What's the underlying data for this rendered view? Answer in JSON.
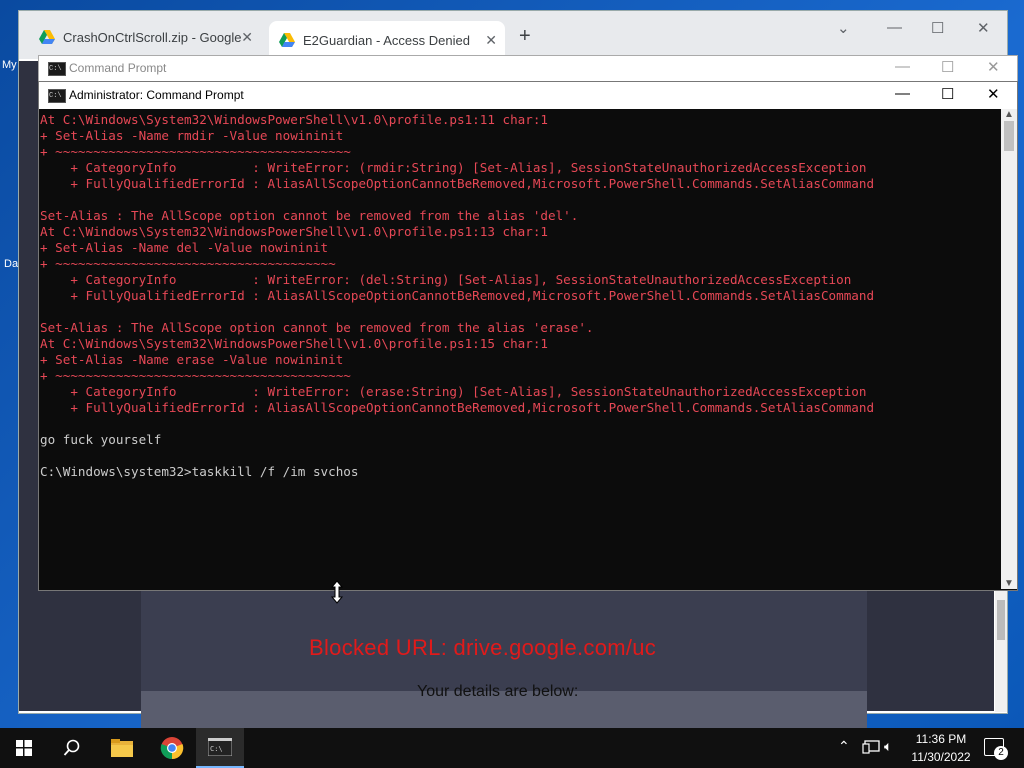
{
  "desktop": {
    "icon_labels": [
      "My",
      "Da"
    ]
  },
  "chrome": {
    "tabs": [
      {
        "title": "CrashOnCtrlScroll.zip - Google D",
        "close": "✕",
        "icon": "google-drive-icon"
      },
      {
        "title": "E2Guardian - Access Denied",
        "close": "✕",
        "icon": "google-drive-icon"
      }
    ],
    "new_tab": "+",
    "page": {
      "blocked_text": "Blocked URL: drive.google.com/uc",
      "details_text": "Your details are below:"
    }
  },
  "cmd_back": {
    "title": "Command Prompt"
  },
  "cmd": {
    "title": "Administrator: Command Prompt",
    "lines": [
      {
        "text": "At C:\\Windows\\System32\\WindowsPowerShell\\v1.0\\profile.ps1:11 char:1",
        "color": "red"
      },
      {
        "text": "+ Set-Alias -Name rmdir -Value nowininit",
        "color": "red"
      },
      {
        "text": "+ ~~~~~~~~~~~~~~~~~~~~~~~~~~~~~~~~~~~~~~~",
        "color": "red"
      },
      {
        "text": "    + CategoryInfo          : WriteError: (rmdir:String) [Set-Alias], SessionStateUnauthorizedAccessException",
        "color": "red"
      },
      {
        "text": "    + FullyQualifiedErrorId : AliasAllScopeOptionCannotBeRemoved,Microsoft.PowerShell.Commands.SetAliasCommand",
        "color": "red"
      },
      {
        "text": "",
        "color": "red"
      },
      {
        "text": "Set-Alias : The AllScope option cannot be removed from the alias 'del'.",
        "color": "red"
      },
      {
        "text": "At C:\\Windows\\System32\\WindowsPowerShell\\v1.0\\profile.ps1:13 char:1",
        "color": "red"
      },
      {
        "text": "+ Set-Alias -Name del -Value nowininit",
        "color": "red"
      },
      {
        "text": "+ ~~~~~~~~~~~~~~~~~~~~~~~~~~~~~~~~~~~~~",
        "color": "red"
      },
      {
        "text": "    + CategoryInfo          : WriteError: (del:String) [Set-Alias], SessionStateUnauthorizedAccessException",
        "color": "red"
      },
      {
        "text": "    + FullyQualifiedErrorId : AliasAllScopeOptionCannotBeRemoved,Microsoft.PowerShell.Commands.SetAliasCommand",
        "color": "red"
      },
      {
        "text": "",
        "color": "red"
      },
      {
        "text": "Set-Alias : The AllScope option cannot be removed from the alias 'erase'.",
        "color": "red"
      },
      {
        "text": "At C:\\Windows\\System32\\WindowsPowerShell\\v1.0\\profile.ps1:15 char:1",
        "color": "red"
      },
      {
        "text": "+ Set-Alias -Name erase -Value nowininit",
        "color": "red"
      },
      {
        "text": "+ ~~~~~~~~~~~~~~~~~~~~~~~~~~~~~~~~~~~~~~~",
        "color": "red"
      },
      {
        "text": "    + CategoryInfo          : WriteError: (erase:String) [Set-Alias], SessionStateUnauthorizedAccessException",
        "color": "red"
      },
      {
        "text": "    + FullyQualifiedErrorId : AliasAllScopeOptionCannotBeRemoved,Microsoft.PowerShell.Commands.SetAliasCommand",
        "color": "red"
      },
      {
        "text": "",
        "color": "white"
      },
      {
        "text": "go fuck yourself",
        "color": "white"
      },
      {
        "text": "",
        "color": "white"
      },
      {
        "text": "C:\\Windows\\system32>taskkill /f /im svchos",
        "color": "white"
      }
    ]
  },
  "taskbar": {
    "time": "11:36 PM",
    "date": "11/30/2022",
    "notifications": "2",
    "icons": [
      "start-icon",
      "search-icon",
      "file-explorer-icon",
      "chrome-icon",
      "command-prompt-icon"
    ]
  }
}
